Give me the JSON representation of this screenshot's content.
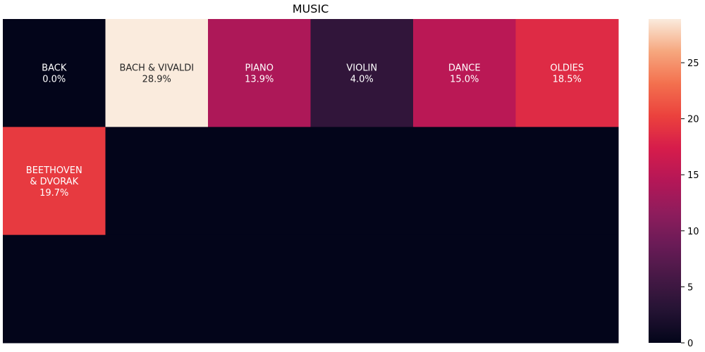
{
  "chart_data": {
    "type": "heatmap",
    "title": "MUSIC",
    "rows": 3,
    "cols": 6,
    "values": [
      [
        0.0,
        28.9,
        13.9,
        4.0,
        15.0,
        18.5
      ],
      [
        19.7,
        0,
        0,
        0,
        0,
        0
      ],
      [
        0,
        0,
        0,
        0,
        0,
        0
      ]
    ],
    "annotations": [
      {
        "row": 0,
        "col": 0,
        "lines": [
          "BACK",
          "0.0%"
        ]
      },
      {
        "row": 0,
        "col": 1,
        "lines": [
          "BACH & VIVALDI",
          "28.9%"
        ]
      },
      {
        "row": 0,
        "col": 2,
        "lines": [
          "PIANO",
          "13.9%"
        ]
      },
      {
        "row": 0,
        "col": 3,
        "lines": [
          "VIOLIN",
          "4.0%"
        ]
      },
      {
        "row": 0,
        "col": 4,
        "lines": [
          "DANCE",
          "15.0%"
        ]
      },
      {
        "row": 0,
        "col": 5,
        "lines": [
          "OLDIES",
          "18.5%"
        ]
      },
      {
        "row": 1,
        "col": 0,
        "lines": [
          "BEETHOVEN",
          "& DVORAK",
          "19.7%"
        ]
      }
    ],
    "colorbar": {
      "colormap": "rocket",
      "min": 0,
      "max": 28.9,
      "ticks": [
        0,
        5,
        10,
        15,
        20,
        25
      ]
    }
  }
}
